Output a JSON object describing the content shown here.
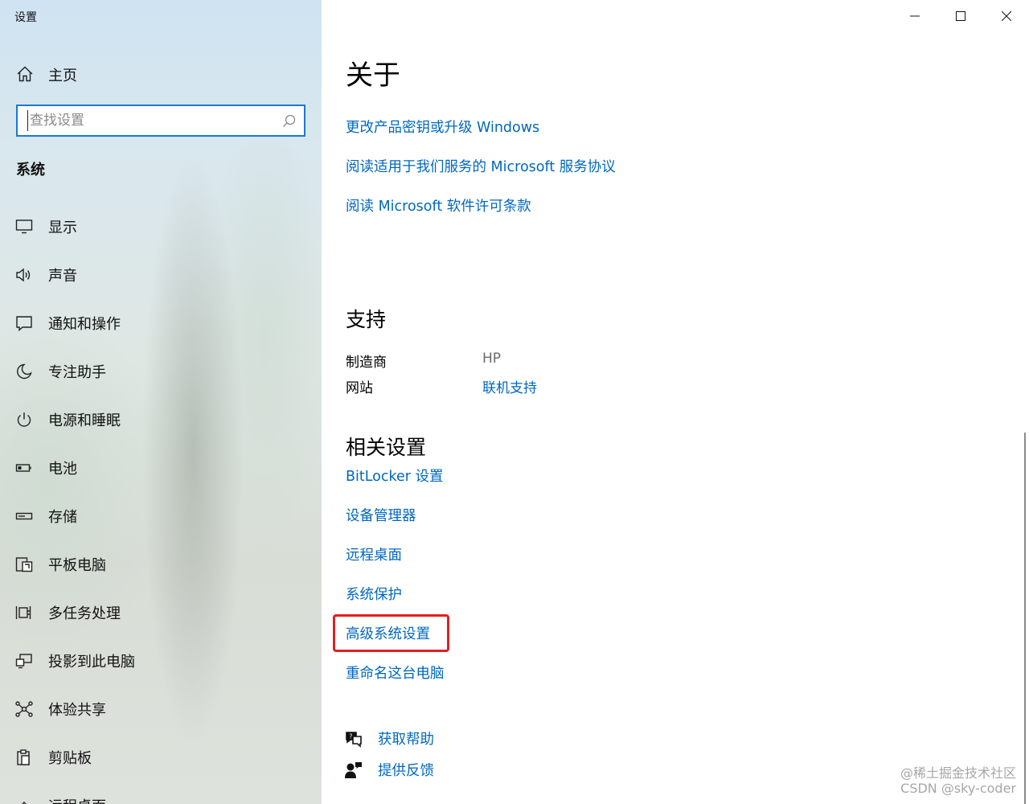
{
  "window": {
    "title": "设置"
  },
  "sidebar": {
    "home_label": "主页",
    "search_placeholder": "查找设置",
    "section_label": "系统",
    "items": [
      {
        "label": "显示",
        "icon": "monitor-icon"
      },
      {
        "label": "声音",
        "icon": "speaker-icon"
      },
      {
        "label": "通知和操作",
        "icon": "notification-icon"
      },
      {
        "label": "专注助手",
        "icon": "moon-icon"
      },
      {
        "label": "电源和睡眠",
        "icon": "power-icon"
      },
      {
        "label": "电池",
        "icon": "battery-icon"
      },
      {
        "label": "存储",
        "icon": "storage-icon"
      },
      {
        "label": "平板电脑",
        "icon": "tablet-icon"
      },
      {
        "label": "多任务处理",
        "icon": "multitask-icon"
      },
      {
        "label": "投影到此电脑",
        "icon": "project-icon"
      },
      {
        "label": "体验共享",
        "icon": "share-icon"
      },
      {
        "label": "剪贴板",
        "icon": "clipboard-icon"
      },
      {
        "label": "远程桌面",
        "icon": "remote-desktop-icon"
      }
    ]
  },
  "main": {
    "title": "关于",
    "top_links": [
      "更改产品密钥或升级 Windows",
      "阅读适用于我们服务的 Microsoft 服务协议",
      "阅读 Microsoft 软件许可条款"
    ],
    "support": {
      "heading": "支持",
      "manufacturer_label": "制造商",
      "manufacturer_value": "HP",
      "website_label": "网站",
      "website_link": "联机支持"
    },
    "related": {
      "heading": "相关设置",
      "links": [
        "BitLocker 设置",
        "设备管理器",
        "远程桌面",
        "系统保护",
        "高级系统设置",
        "重命名这台电脑"
      ],
      "highlighted": "高级系统设置",
      "highlight_color": "#e02020"
    },
    "help": {
      "get_help": "获取帮助",
      "feedback": "提供反馈"
    }
  },
  "watermark": {
    "line1": "@稀土掘金技术社区",
    "line2": "CSDN @sky-coder"
  },
  "colors": {
    "link": "#0067c0",
    "accent": "#1a78d3"
  }
}
